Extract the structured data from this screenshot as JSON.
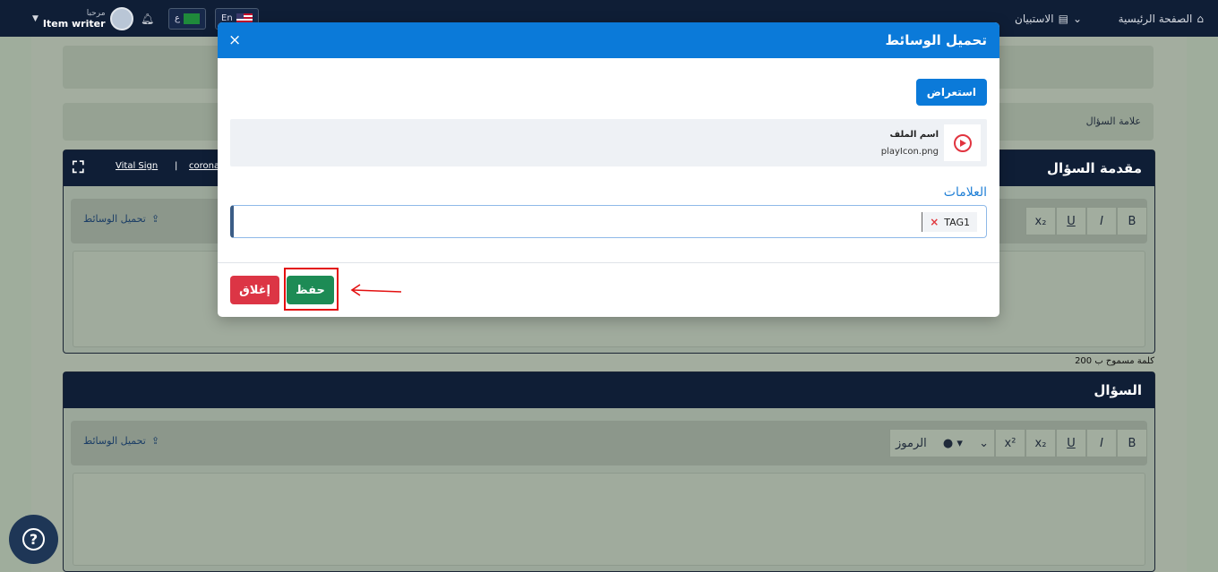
{
  "topbar": {
    "home": "الصفحة الرئيسية",
    "surveys": "الاستبيان",
    "lang_ar": "ع",
    "lang_en": "En",
    "greeting": "مرحبا",
    "username": "Item writer"
  },
  "background": {
    "question_mark_label": "علامة السؤال",
    "intro_title": "مقدمة السؤال",
    "intro_links": [
      "Vital Sign",
      "corona"
    ],
    "intro_link_sep": "|",
    "upload_media": "تحميل الوسائط",
    "word_limit": "200 كلمة مسموح ب",
    "question_title": "السؤال",
    "symbols_label": "الرموز",
    "toolbar_buttons": [
      "B",
      "I",
      "U",
      "x₂",
      "x²"
    ]
  },
  "modal": {
    "title": "تحميل الوسائط",
    "close_icon": "×",
    "browse_button": "استعراض",
    "file": {
      "label": "اسم الملف",
      "name": "playIcon.png"
    },
    "tags_label": "العلامات",
    "tags": [
      {
        "text": "TAG1",
        "remove": "×"
      }
    ],
    "save_button": "حفظ",
    "close_button": "إغلاق"
  },
  "colors": {
    "modal_header": "#0b7ad9",
    "save": "#1d8b55",
    "close": "#dc3545",
    "navbar": "#0f1e36",
    "highlight": "#e31010"
  }
}
